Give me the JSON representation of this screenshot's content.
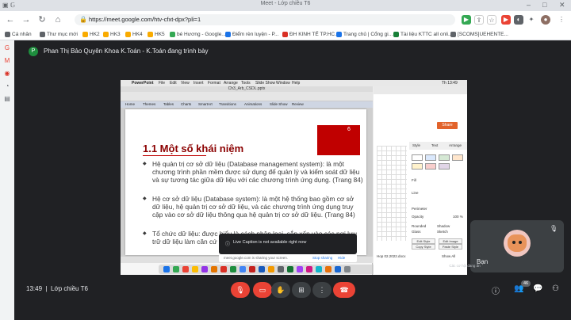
{
  "browser": {
    "window_title": "Meet - Lớp chiều T6",
    "url": "https://meet.google.com/htv-cfxt-dpx?pli=1"
  },
  "bookmarks": [
    {
      "label": "Cá nhân",
      "color": "#5f6368"
    },
    {
      "label": "Thư mục mới",
      "color": "#5f6368"
    },
    {
      "label": "HK2",
      "color": "#f9ab00"
    },
    {
      "label": "HK3",
      "color": "#f9ab00"
    },
    {
      "label": "HK4",
      "color": "#f9ab00"
    },
    {
      "label": "HK5",
      "color": "#f9ab00"
    },
    {
      "label": "bé Hương - Google...",
      "color": "#34a853"
    },
    {
      "label": "Điểm rèn luyện - P...",
      "color": "#1a73e8"
    },
    {
      "label": "ĐH KINH TẾ TP.HC...",
      "color": "#d93025"
    },
    {
      "label": "Trang chủ | Cổng gi...",
      "color": "#1a73e8"
    },
    {
      "label": "Tài liệu KTTC all onli...",
      "color": "#188038"
    },
    {
      "label": "[SCOMS]UEHENTE...",
      "color": "#5f6368"
    }
  ],
  "meet": {
    "presenter_initial": "P",
    "presenter_text": "Phan Thị Bảo Quyên Khoa K.Toán - K.Toán đang trình bày",
    "time": "13:49",
    "meeting_name": "Lớp chiều T6",
    "self_label": "Bạn",
    "participant_count": "46",
    "hint": "Các cơ hội đang ẩn"
  },
  "shared_screen": {
    "menubar": [
      "PowerPoint",
      "File",
      "Edit",
      "View",
      "Insert",
      "Format",
      "Arrange",
      "Tools",
      "Slide Show",
      "Window",
      "Help"
    ],
    "clock": "Th 13:49",
    "ppt_title": "Ch3_Arb_CSDL.pptx",
    "ribbon_tabs": [
      "Home",
      "Themes",
      "Tables",
      "Charts",
      "SmartArt",
      "Transitions",
      "Animations",
      "Slide Show",
      "Review"
    ],
    "slide": {
      "number": "6",
      "heading": "1.1 Một số khái niệm",
      "bullets": [
        "Hệ quản trị cơ sở dữ liệu (Database management system): là một chương trình phần mềm được sử dụng để quản lý và kiểm soát dữ liệu và sự tương tác giữa dữ liệu với các chương trình ứng dụng. (Trang 84)",
        "Hệ cơ sở dữ liệu (Database system): là một hệ thống bao gồm cơ sở dữ liệu, hệ quản trị cơ sở dữ liệu, và các chương trình ứng dụng truy cập vào cơ sở dữ liệu thông qua hệ quản trị cơ sở dữ liệu. (Trang 84)",
        "Tổ chức dữ liệu: được hiểu là cách phân loại, sắp xếp vào các nơi lưu trữ dữ liệu làm căn cứ cho việc xử lí dữ liệu."
      ]
    },
    "live_caption": "Live Caption is not available right now",
    "sharing_msg": "meet.google.com is sharing your screen.",
    "stop_sharing": "Stop sharing",
    "hide": "Hide",
    "side_app": {
      "share_btn": "Share",
      "tabs": [
        "Style",
        "Text",
        "Arrange"
      ],
      "options": [
        "Fill",
        "Line",
        "Perimeter",
        "Opacity",
        "Rounded",
        "Glass",
        "Shadow",
        "Sketch"
      ],
      "opacity_value": "100 %",
      "buttons": [
        "Edit Style",
        "Edit Image",
        "Copy Style",
        "Paste Style"
      ],
      "status": "Show All",
      "doc_name": "Hop 02.2022.docx"
    }
  }
}
